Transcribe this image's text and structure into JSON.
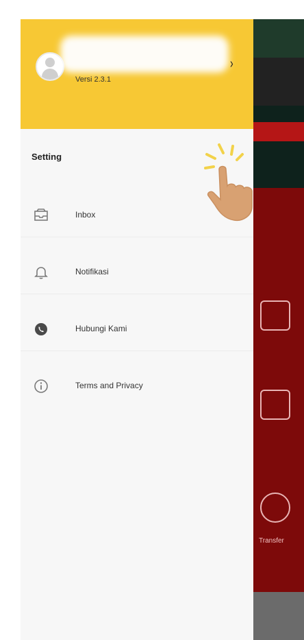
{
  "drawer": {
    "version": "Versi 2.3.1",
    "setting_title": "Setting",
    "items": [
      {
        "label": "Inbox",
        "icon": "inbox-icon"
      },
      {
        "label": "Notifikasi",
        "icon": "bell-icon"
      },
      {
        "label": "Hubungi Kami",
        "icon": "phone-icon"
      },
      {
        "label": "Terms and Privacy",
        "icon": "info-icon"
      }
    ]
  },
  "background_app": {
    "labels": [
      "Transfer"
    ]
  },
  "colors": {
    "header": "#f7c834",
    "drawer_bg": "#f7f7f7",
    "app_red": "#7d0a0a"
  }
}
